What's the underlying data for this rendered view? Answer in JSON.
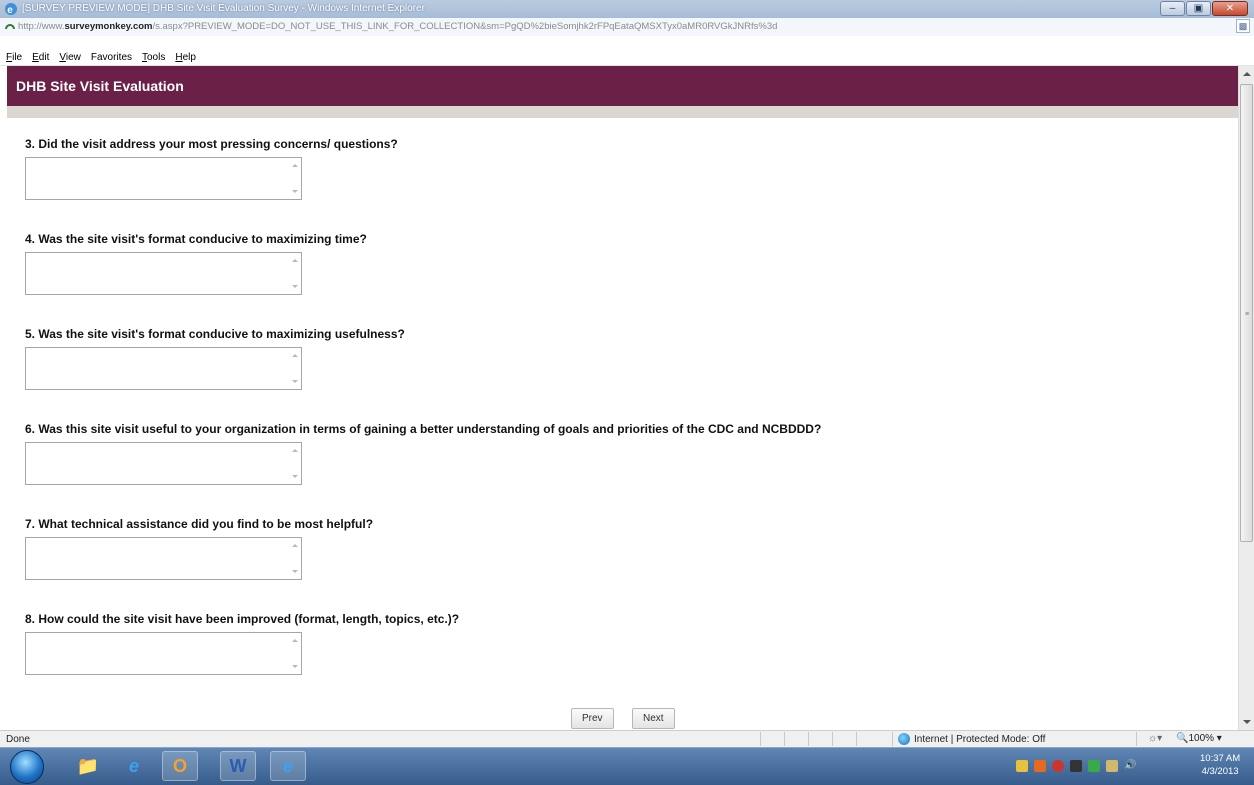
{
  "window": {
    "title": "[SURVEY PREVIEW MODE] DHB Site Visit Evaluation Survey - Windows Internet Explorer",
    "address_prefix": "http://www.",
    "address_domain": "surveymonkey.com",
    "address_rest": "/s.aspx?PREVIEW_MODE=DO_NOT_USE_THIS_LINK_FOR_COLLECTION&sm=PgQD%2bieSomjhk2rFPqEataQMSXTyx0aMR0RVGkJNRfs%3d"
  },
  "menu": {
    "items": [
      {
        "first": "F",
        "rest": "ile"
      },
      {
        "first": "E",
        "rest": "dit"
      },
      {
        "first": "V",
        "rest": "iew"
      },
      {
        "first": "Fa",
        "rest": "vorites",
        "pre": ""
      },
      {
        "first": "T",
        "rest": "ools"
      },
      {
        "first": "H",
        "rest": "elp"
      }
    ]
  },
  "survey": {
    "title": "DHB Site Visit Evaluation",
    "questions": [
      "3. Did the visit address your most pressing concerns/ questions?",
      "4. Was the site visit's format conducive to maximizing time?",
      "5. Was the site visit's format conducive to maximizing usefulness?",
      "6. Was this site visit useful to your organization in terms of gaining a better understanding of goals and priorities of the CDC and NCBDDD?",
      "7. What technical assistance did you find to be most helpful?",
      "8. How could the site visit have been improved (format, length, topics, etc.)?"
    ],
    "prev_label": "Prev",
    "next_label": "Next"
  },
  "status": {
    "left": "Done",
    "zone": "Internet | Protected Mode: Off",
    "zoom": "100%"
  },
  "clock": {
    "time": "10:37 AM",
    "date": "4/3/2013"
  },
  "colors": {
    "header": "#6b2048",
    "strip": "#dcd6d0"
  }
}
